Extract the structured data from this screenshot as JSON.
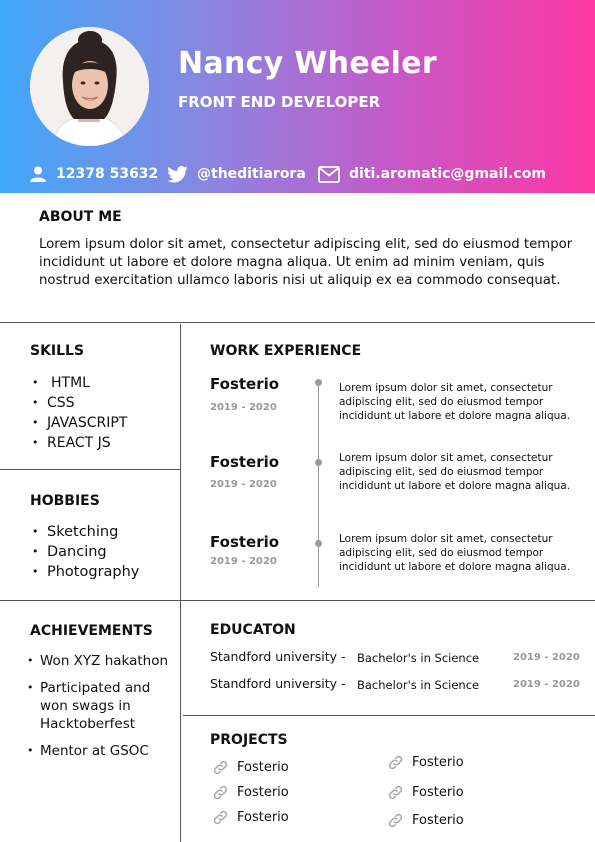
{
  "header": {
    "name": "Nancy Wheeler",
    "role": "FRONT END DEVELOPER",
    "phone": "12378 53632",
    "twitter": "@theditiarora",
    "email": "diti.aromatic@gmail.com",
    "gradient_colors": [
      "#3fa8f8",
      "#8a86e0",
      "#c45ac8",
      "#fd37a4"
    ]
  },
  "about": {
    "title": "ABOUT ME",
    "text": "Lorem ipsum dolor sit amet, consectetur adipiscing elit, sed do eiusmod tempor incididunt ut labore et dolore magna aliqua. Ut enim ad minim veniam, quis nostrud exercitation ullamco laboris nisi ut aliquip ex ea commodo consequat."
  },
  "skills": {
    "title": "SKILLS",
    "items": [
      "HTML",
      "CSS",
      "JAVASCRIPT",
      "REACT JS"
    ]
  },
  "hobbies": {
    "title": "HOBBIES",
    "items": [
      "Sketching",
      "Dancing",
      "Photography"
    ]
  },
  "achievements": {
    "title": "ACHIEVEMENTS",
    "items": [
      "Won XYZ hakathon",
      "Participated and won swags in Hacktoberfest",
      "Mentor at GSOC"
    ]
  },
  "work": {
    "title": "WORK EXPERIENCE",
    "entries": [
      {
        "company": "Fosterio",
        "dates": "2019 - 2020",
        "description": "Lorem ipsum dolor sit amet, consectetur adipiscing elit, sed do eiusmod tempor incididunt ut labore et dolore magna aliqua."
      },
      {
        "company": "Fosterio",
        "dates": "2019 - 2020",
        "description": "Lorem ipsum dolor sit amet, consectetur adipiscing elit, sed do eiusmod tempor incididunt ut labore et dolore magna aliqua."
      },
      {
        "company": "Fosterio",
        "dates": "2019 - 2020",
        "description": "Lorem ipsum dolor sit amet, consectetur adipiscing elit, sed do eiusmod tempor incididunt ut labore et dolore magna aliqua."
      }
    ]
  },
  "education": {
    "title": "EDUCATON",
    "entries": [
      {
        "university": "Standford university -",
        "degree": "Bachelor's in Science",
        "dates": "2019 - 2020"
      },
      {
        "university": "Standford university -",
        "degree": "Bachelor's in Science",
        "dates": "2019 - 2020"
      }
    ]
  },
  "projects": {
    "title": "PROJECTS",
    "left": [
      "Fosterio",
      "Fosterio",
      "Fosterio"
    ],
    "right": [
      "Fosterio",
      "Fosterio",
      "Fosterio"
    ]
  }
}
